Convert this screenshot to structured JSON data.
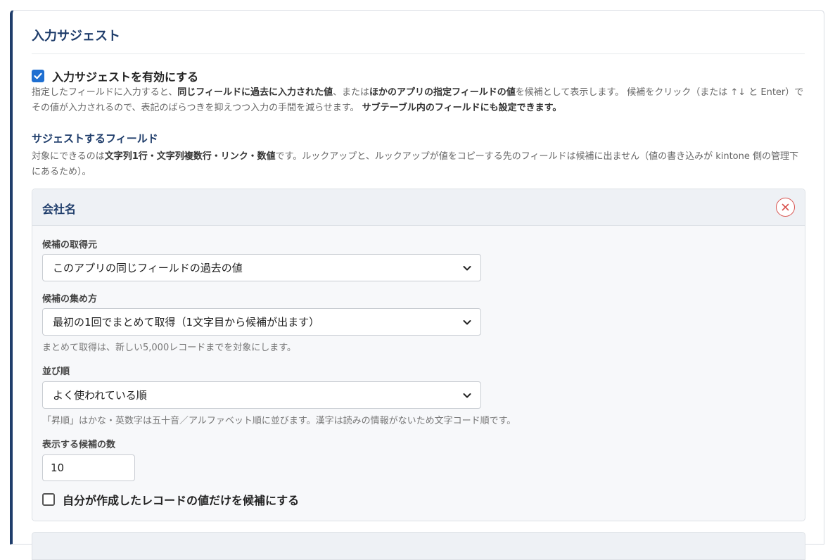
{
  "card": {
    "title": "入力サジェスト",
    "enable_label": "入力サジェストを有効にする",
    "enable_checked": true,
    "desc_parts": [
      "指定したフィールドに入力すると、",
      "同じフィールドに過去に入力された値",
      "、または",
      "ほかのアプリの指定フィールドの値",
      "を候補として表示します。 候補をクリック（または ↑↓ と Enter）でその値が入力されるので、表記のばらつきを抑えつつ入力の手間を減らせます。 ",
      "サブテーブル内のフィールドにも設定できます。"
    ]
  },
  "section": {
    "title": "サジェストするフィールド",
    "desc_parts": [
      "対象にできるのは",
      "文字列1行・文字列複数行・リンク・数値",
      "です。ルックアップと、ルックアップが値をコピーする先のフィールドは候補に出ません（値の書き込みが kintone 側の管理下にあるため）。"
    ]
  },
  "field": {
    "title": "会社名",
    "source_label": "候補の取得元",
    "source_value": "このアプリの同じフィールドの過去の値",
    "collect_label": "候補の集め方",
    "collect_value": "最初の1回でまとめて取得（1文字目から候補が出ます）",
    "collect_help": "まとめて取得は、新しい5,000レコードまでを対象にします。",
    "order_label": "並び順",
    "order_value": "よく使われている順",
    "order_help": "「昇順」はかな・英数字は五十音／アルファベット順に並びます。漢字は読みの情報がないため文字コード順です。",
    "count_label": "表示する候補の数",
    "count_value": "10",
    "own_label": "自分が作成したレコードの値だけを候補にする",
    "own_checked": false
  },
  "colors": {
    "accent": "#1f3d6b",
    "checkbox": "#1f6fd1",
    "remove": "#d9534f"
  },
  "icons": {
    "remove": "close-icon",
    "select": "chevron-down-icon",
    "check": "check-icon"
  }
}
